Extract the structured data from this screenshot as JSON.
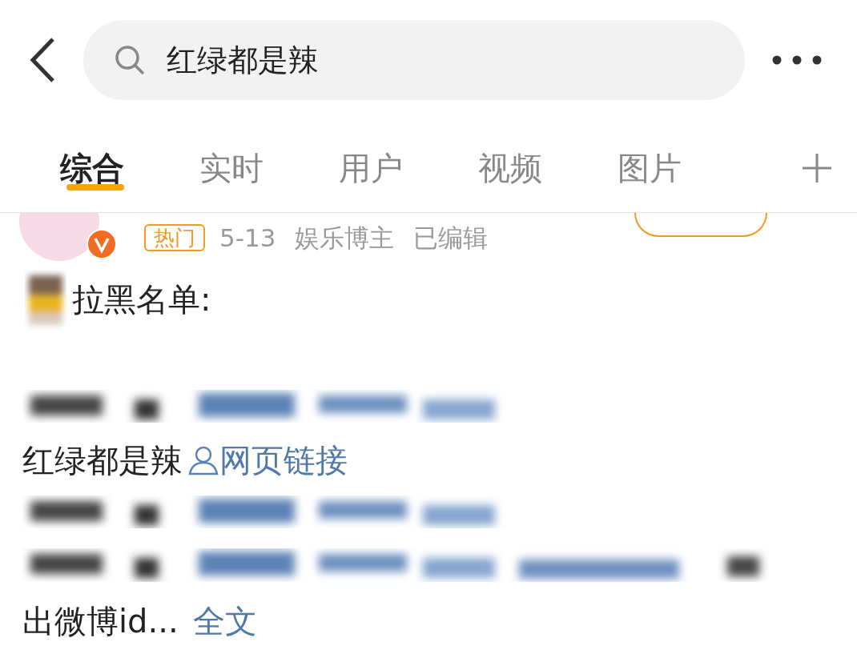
{
  "search": {
    "value": "红绿都是辣"
  },
  "tabs": [
    {
      "label": "综合",
      "selected": true
    },
    {
      "label": "实时",
      "selected": false
    },
    {
      "label": "用户",
      "selected": false
    },
    {
      "label": "视频",
      "selected": false
    },
    {
      "label": "图片",
      "selected": false
    }
  ],
  "post": {
    "badge": "热门",
    "date": "5-13",
    "category": "娱乐博主",
    "edited": "已编辑",
    "lines": [
      {
        "kind": "text",
        "text": "拉黑名单:",
        "lead_image": true
      },
      {
        "kind": "blank"
      },
      {
        "kind": "redacted"
      },
      {
        "kind": "link",
        "text": "红绿都是辣",
        "link": "网页链接"
      },
      {
        "kind": "redacted"
      },
      {
        "kind": "redacted"
      },
      {
        "kind": "more",
        "text": "出微博id...",
        "link": "全文"
      }
    ]
  }
}
